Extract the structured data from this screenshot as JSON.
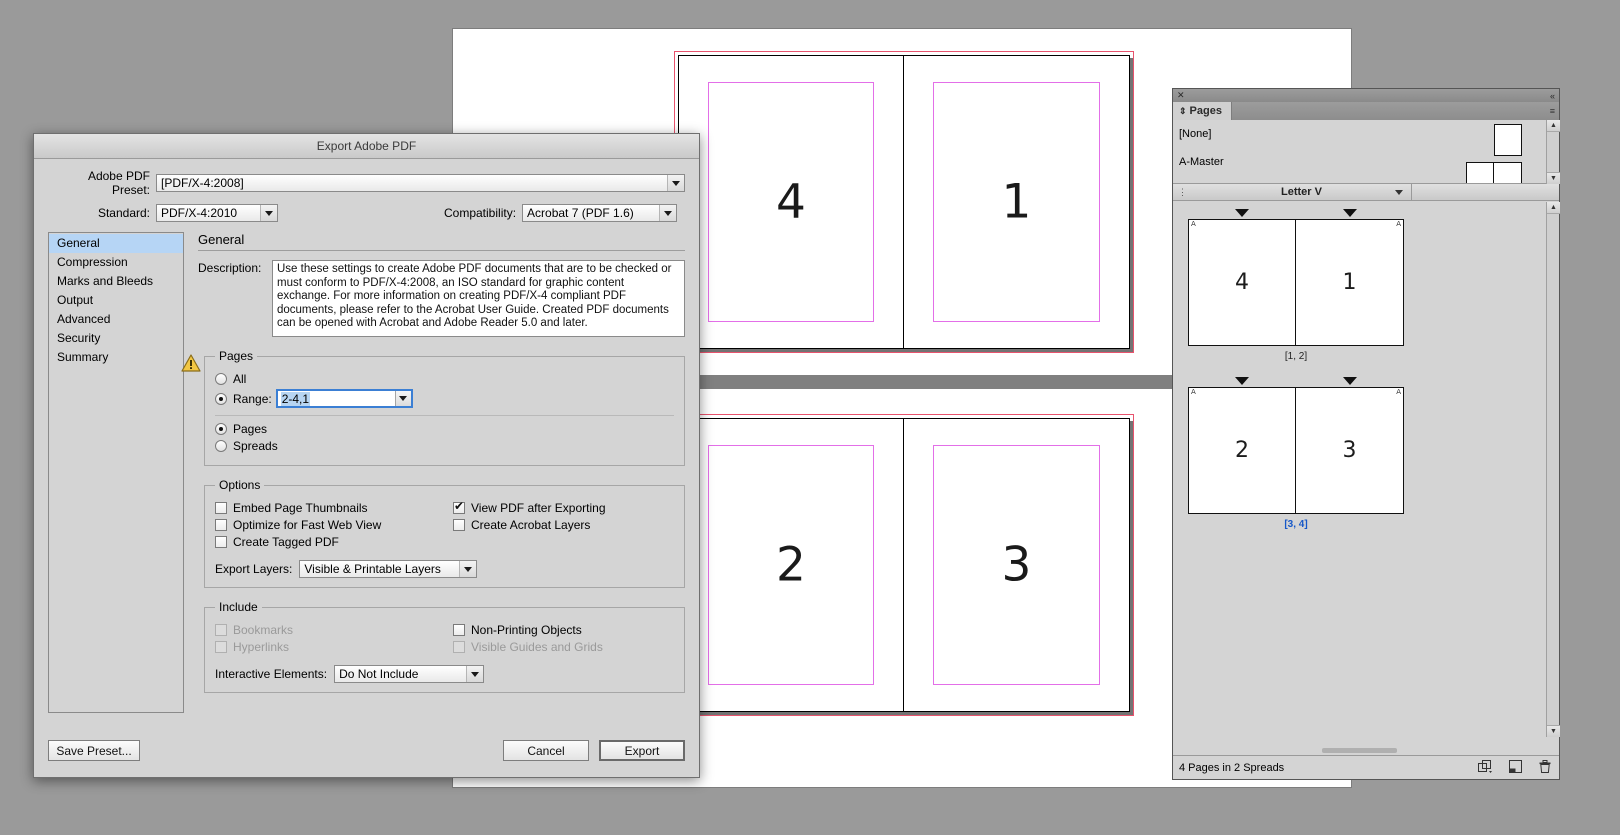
{
  "dialog": {
    "title": "Export Adobe PDF",
    "preset": {
      "label": "Adobe PDF Preset:",
      "value": "[PDF/X-4:2008]"
    },
    "standard": {
      "label": "Standard:",
      "value": "PDF/X-4:2010"
    },
    "compatibility": {
      "label": "Compatibility:",
      "value": "Acrobat 7 (PDF 1.6)"
    },
    "nav": {
      "items": [
        {
          "label": "General",
          "selected": true
        },
        {
          "label": "Compression",
          "selected": false
        },
        {
          "label": "Marks and Bleeds",
          "selected": false
        },
        {
          "label": "Output",
          "selected": false
        },
        {
          "label": "Advanced",
          "selected": false
        },
        {
          "label": "Security",
          "selected": false
        },
        {
          "label": "Summary",
          "selected": false
        }
      ],
      "warning_icon": "warning-triangle-icon"
    },
    "panel": {
      "title": "General",
      "description_label": "Description:",
      "description_value": "Use these settings to create Adobe PDF documents that are to be checked or must conform to PDF/X-4:2008, an ISO standard for graphic content exchange.  For more information on creating PDF/X-4 compliant PDF documents, please refer to the Acrobat User Guide.  Created PDF documents can be opened with Acrobat and Adobe Reader 5.0 and later."
    },
    "pages_group": {
      "legend": "Pages",
      "all_label": "All",
      "all_selected": false,
      "range_label": "Range:",
      "range_selected": true,
      "range_value": "2-4,1",
      "pages_label": "Pages",
      "pages_selected": true,
      "spreads_label": "Spreads",
      "spreads_selected": false
    },
    "options_group": {
      "legend": "Options",
      "checks": [
        {
          "label": "Embed Page Thumbnails",
          "checked": false,
          "disabled": false
        },
        {
          "label": "Optimize for Fast Web View",
          "checked": false,
          "disabled": false
        },
        {
          "label": "Create Tagged PDF",
          "checked": false,
          "disabled": false
        },
        {
          "label": "View PDF after Exporting",
          "checked": true,
          "disabled": false
        },
        {
          "label": "Create Acrobat Layers",
          "checked": false,
          "disabled": false
        }
      ],
      "export_layers_label": "Export Layers:",
      "export_layers_value": "Visible & Printable Layers"
    },
    "include_group": {
      "legend": "Include",
      "checks": [
        {
          "label": "Bookmarks",
          "checked": false,
          "disabled": true
        },
        {
          "label": "Hyperlinks",
          "checked": false,
          "disabled": true
        },
        {
          "label": "Non-Printing Objects",
          "checked": false,
          "disabled": false
        },
        {
          "label": "Visible Guides and Grids",
          "checked": false,
          "disabled": true
        }
      ],
      "interactive_label": "Interactive Elements:",
      "interactive_value": "Do Not Include"
    },
    "buttons": {
      "save_preset": "Save Preset...",
      "cancel": "Cancel",
      "export": "Export"
    }
  },
  "document": {
    "spreads": [
      {
        "left_page": "4",
        "right_page": "1"
      },
      {
        "left_page": "2",
        "right_page": "3"
      }
    ]
  },
  "pages_panel": {
    "close_icon": "close-icon",
    "collapse_icon": "collapse-panel-icon",
    "menu_icon": "panel-menu-icon",
    "tab_label": "Pages",
    "tab_grip_icon": "updown-grip-icon",
    "masters": [
      {
        "label": "[None]"
      },
      {
        "label": "A-Master"
      }
    ],
    "size_bar": {
      "grip_icon": "drag-grip-icon",
      "value": "Letter V"
    },
    "spreads": [
      {
        "left_page": "4",
        "right_page": "1",
        "left_master": "A",
        "right_master": "A",
        "label": "[1, 2]",
        "selected": false
      },
      {
        "left_page": "2",
        "right_page": "3",
        "left_master": "A",
        "right_master": "A",
        "label": "[3, 4]",
        "selected": true
      }
    ],
    "status_text": "4 Pages in 2 Spreads",
    "status_icons": [
      "edit-page-size-icon",
      "new-page-icon",
      "delete-page-icon"
    ],
    "scroll_up_icon": "scroll-up-icon",
    "scroll_down_icon": "scroll-down-icon"
  },
  "colors": {
    "selection_blue": "#b6d5f5",
    "focus_blue": "#3b7fd4",
    "bleed_red": "#e8536d",
    "margin_magenta": "#e36fe8",
    "panel_gray": "#d4d4d4",
    "desktop_gray": "#9a9a9a"
  }
}
